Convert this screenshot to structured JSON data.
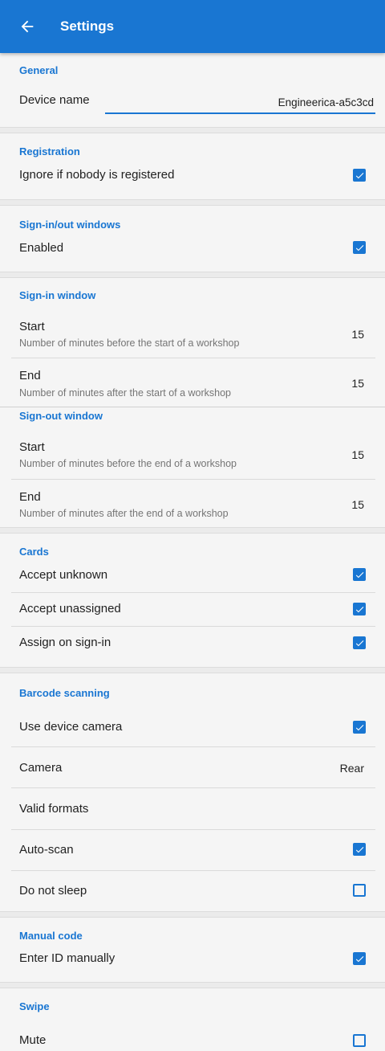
{
  "appbar": {
    "title": "Settings"
  },
  "general": {
    "title": "General",
    "device_name_label": "Device name",
    "device_name_value": "Engineerica-a5c3cd"
  },
  "registration": {
    "title": "Registration",
    "ignore_label": "Ignore if nobody is registered",
    "ignore_checked": true
  },
  "signinout": {
    "title": "Sign-in/out windows",
    "enabled_label": "Enabled",
    "enabled_checked": true
  },
  "signin_window": {
    "title": "Sign-in window",
    "start_label": "Start",
    "start_sub": "Number of minutes before the start of a workshop",
    "start_value": "15",
    "end_label": "End",
    "end_sub": "Number of minutes after the start of a workshop",
    "end_value": "15"
  },
  "signout_window": {
    "title": "Sign-out window",
    "start_label": "Start",
    "start_sub": "Number of minutes before the end of a workshop",
    "start_value": "15",
    "end_label": "End",
    "end_sub": "Number of minutes after the end of a workshop",
    "end_value": "15"
  },
  "cards": {
    "title": "Cards",
    "accept_unknown_label": "Accept unknown",
    "accept_unknown_checked": true,
    "accept_unassigned_label": "Accept unassigned",
    "accept_unassigned_checked": true,
    "assign_label": "Assign on sign-in",
    "assign_checked": true
  },
  "barcode": {
    "title": "Barcode scanning",
    "use_camera_label": "Use device camera",
    "use_camera_checked": true,
    "camera_label": "Camera",
    "camera_value": "Rear",
    "formats_label": "Valid formats",
    "autoscan_label": "Auto-scan",
    "autoscan_checked": true,
    "nosleep_label": "Do not sleep",
    "nosleep_checked": false
  },
  "manual": {
    "title": "Manual code",
    "enter_label": "Enter ID manually",
    "enter_checked": true
  },
  "swipe": {
    "title": "Swipe",
    "mute_label": "Mute",
    "mute_checked": false
  },
  "colors": {
    "accent": "#1976d2",
    "background": "#f5f5f5"
  },
  "icons": {
    "back": "arrow-left-icon",
    "checked": "checkbox-checked-icon",
    "unchecked": "checkbox-unchecked-icon"
  }
}
